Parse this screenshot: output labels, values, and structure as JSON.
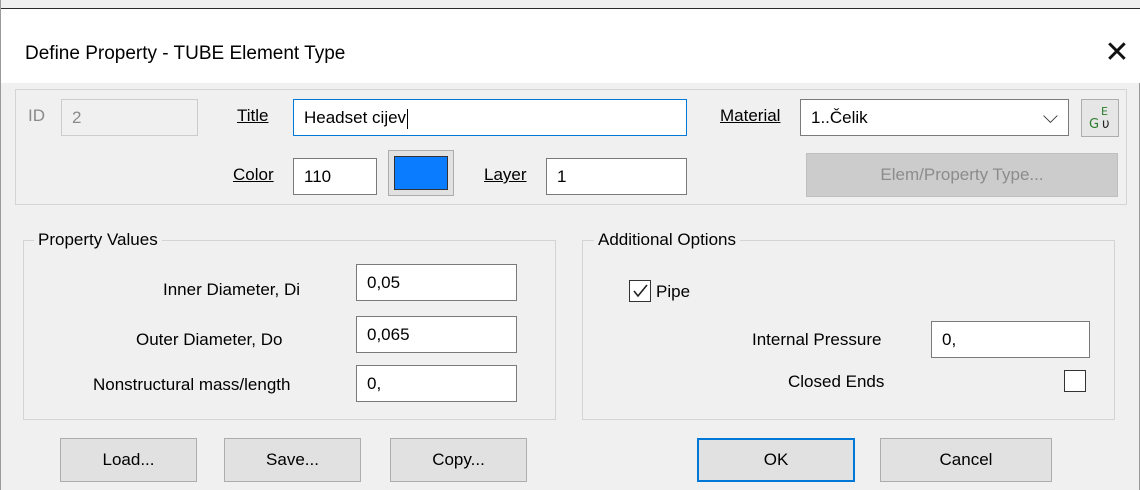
{
  "window": {
    "title": "Define Property - TUBE Element Type",
    "close_glyph": "✕"
  },
  "header": {
    "id_label": "ID",
    "id_value": "2",
    "title_label": "Title",
    "title_value": "Headset cijev",
    "color_label": "Color",
    "color_value": "110",
    "color_swatch": "#0a7cff",
    "layer_label": "Layer",
    "layer_value": "1",
    "material_label": "Material",
    "material_value": "1..Čelik",
    "dropdown_glyph": "⌵",
    "elem_property_button": "Elem/Property Type..."
  },
  "property_values": {
    "legend": "Property Values",
    "fields": [
      {
        "label": "Inner Diameter,  Di",
        "value": "0,05"
      },
      {
        "label": "Outer Diameter,  Do",
        "value": "0,065"
      },
      {
        "label": "Nonstructural mass/length",
        "value": "0,"
      }
    ]
  },
  "additional_options": {
    "legend": "Additional Options",
    "pipe_label": "Pipe",
    "pipe_checked": true,
    "internal_pressure_label": "Internal Pressure",
    "internal_pressure_value": "0,",
    "closed_ends_label": "Closed Ends",
    "closed_ends_checked": false
  },
  "buttons": {
    "load": "Load...",
    "save": "Save...",
    "copy": "Copy...",
    "ok": "OK",
    "cancel": "Cancel"
  }
}
